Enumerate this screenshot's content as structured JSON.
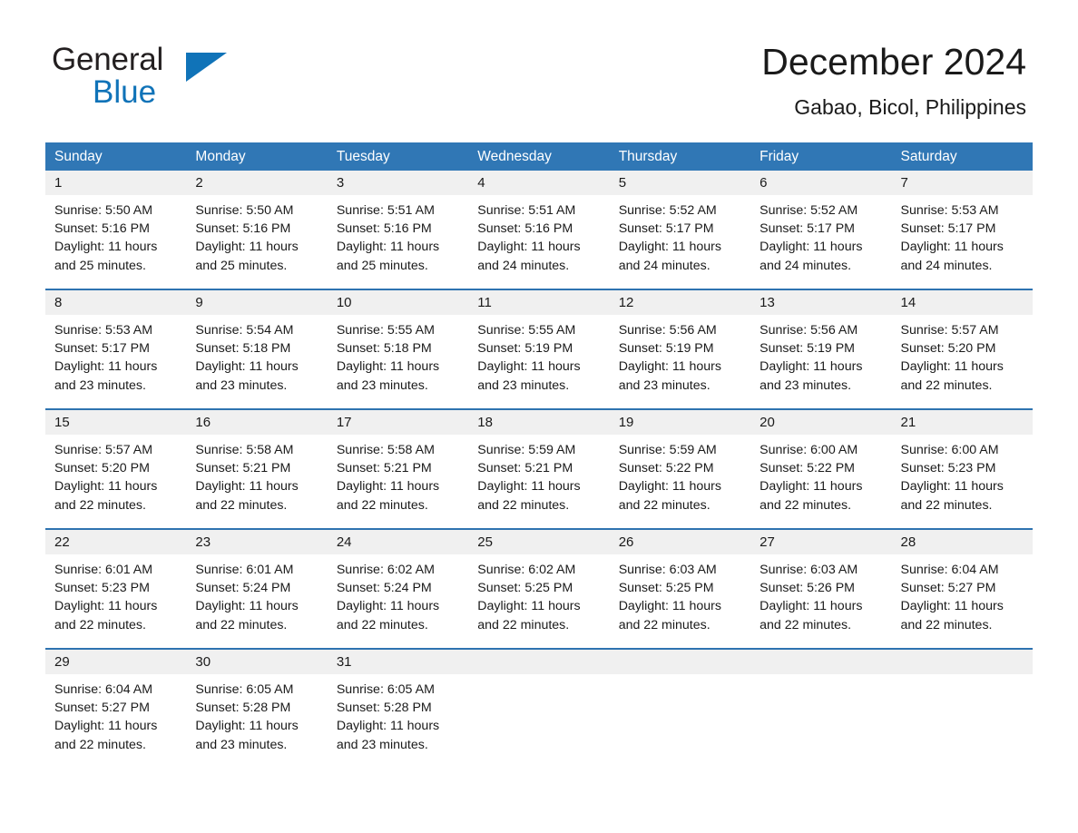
{
  "brand": {
    "name_part1": "General",
    "name_part2": "Blue",
    "accent_color": "#1073b8"
  },
  "header": {
    "title": "December 2024",
    "location": "Gabao, Bicol, Philippines"
  },
  "calendar": {
    "header_bg": "#3077b5",
    "row_separator_color": "#2e73b0",
    "daynum_bg": "#f0f0f0",
    "weekdays": [
      "Sunday",
      "Monday",
      "Tuesday",
      "Wednesday",
      "Thursday",
      "Friday",
      "Saturday"
    ],
    "weeks": [
      [
        {
          "day": "1",
          "sunrise": "Sunrise: 5:50 AM",
          "sunset": "Sunset: 5:16 PM",
          "daylight": "Daylight: 11 hours and 25 minutes."
        },
        {
          "day": "2",
          "sunrise": "Sunrise: 5:50 AM",
          "sunset": "Sunset: 5:16 PM",
          "daylight": "Daylight: 11 hours and 25 minutes."
        },
        {
          "day": "3",
          "sunrise": "Sunrise: 5:51 AM",
          "sunset": "Sunset: 5:16 PM",
          "daylight": "Daylight: 11 hours and 25 minutes."
        },
        {
          "day": "4",
          "sunrise": "Sunrise: 5:51 AM",
          "sunset": "Sunset: 5:16 PM",
          "daylight": "Daylight: 11 hours and 24 minutes."
        },
        {
          "day": "5",
          "sunrise": "Sunrise: 5:52 AM",
          "sunset": "Sunset: 5:17 PM",
          "daylight": "Daylight: 11 hours and 24 minutes."
        },
        {
          "day": "6",
          "sunrise": "Sunrise: 5:52 AM",
          "sunset": "Sunset: 5:17 PM",
          "daylight": "Daylight: 11 hours and 24 minutes."
        },
        {
          "day": "7",
          "sunrise": "Sunrise: 5:53 AM",
          "sunset": "Sunset: 5:17 PM",
          "daylight": "Daylight: 11 hours and 24 minutes."
        }
      ],
      [
        {
          "day": "8",
          "sunrise": "Sunrise: 5:53 AM",
          "sunset": "Sunset: 5:17 PM",
          "daylight": "Daylight: 11 hours and 23 minutes."
        },
        {
          "day": "9",
          "sunrise": "Sunrise: 5:54 AM",
          "sunset": "Sunset: 5:18 PM",
          "daylight": "Daylight: 11 hours and 23 minutes."
        },
        {
          "day": "10",
          "sunrise": "Sunrise: 5:55 AM",
          "sunset": "Sunset: 5:18 PM",
          "daylight": "Daylight: 11 hours and 23 minutes."
        },
        {
          "day": "11",
          "sunrise": "Sunrise: 5:55 AM",
          "sunset": "Sunset: 5:19 PM",
          "daylight": "Daylight: 11 hours and 23 minutes."
        },
        {
          "day": "12",
          "sunrise": "Sunrise: 5:56 AM",
          "sunset": "Sunset: 5:19 PM",
          "daylight": "Daylight: 11 hours and 23 minutes."
        },
        {
          "day": "13",
          "sunrise": "Sunrise: 5:56 AM",
          "sunset": "Sunset: 5:19 PM",
          "daylight": "Daylight: 11 hours and 23 minutes."
        },
        {
          "day": "14",
          "sunrise": "Sunrise: 5:57 AM",
          "sunset": "Sunset: 5:20 PM",
          "daylight": "Daylight: 11 hours and 22 minutes."
        }
      ],
      [
        {
          "day": "15",
          "sunrise": "Sunrise: 5:57 AM",
          "sunset": "Sunset: 5:20 PM",
          "daylight": "Daylight: 11 hours and 22 minutes."
        },
        {
          "day": "16",
          "sunrise": "Sunrise: 5:58 AM",
          "sunset": "Sunset: 5:21 PM",
          "daylight": "Daylight: 11 hours and 22 minutes."
        },
        {
          "day": "17",
          "sunrise": "Sunrise: 5:58 AM",
          "sunset": "Sunset: 5:21 PM",
          "daylight": "Daylight: 11 hours and 22 minutes."
        },
        {
          "day": "18",
          "sunrise": "Sunrise: 5:59 AM",
          "sunset": "Sunset: 5:21 PM",
          "daylight": "Daylight: 11 hours and 22 minutes."
        },
        {
          "day": "19",
          "sunrise": "Sunrise: 5:59 AM",
          "sunset": "Sunset: 5:22 PM",
          "daylight": "Daylight: 11 hours and 22 minutes."
        },
        {
          "day": "20",
          "sunrise": "Sunrise: 6:00 AM",
          "sunset": "Sunset: 5:22 PM",
          "daylight": "Daylight: 11 hours and 22 minutes."
        },
        {
          "day": "21",
          "sunrise": "Sunrise: 6:00 AM",
          "sunset": "Sunset: 5:23 PM",
          "daylight": "Daylight: 11 hours and 22 minutes."
        }
      ],
      [
        {
          "day": "22",
          "sunrise": "Sunrise: 6:01 AM",
          "sunset": "Sunset: 5:23 PM",
          "daylight": "Daylight: 11 hours and 22 minutes."
        },
        {
          "day": "23",
          "sunrise": "Sunrise: 6:01 AM",
          "sunset": "Sunset: 5:24 PM",
          "daylight": "Daylight: 11 hours and 22 minutes."
        },
        {
          "day": "24",
          "sunrise": "Sunrise: 6:02 AM",
          "sunset": "Sunset: 5:24 PM",
          "daylight": "Daylight: 11 hours and 22 minutes."
        },
        {
          "day": "25",
          "sunrise": "Sunrise: 6:02 AM",
          "sunset": "Sunset: 5:25 PM",
          "daylight": "Daylight: 11 hours and 22 minutes."
        },
        {
          "day": "26",
          "sunrise": "Sunrise: 6:03 AM",
          "sunset": "Sunset: 5:25 PM",
          "daylight": "Daylight: 11 hours and 22 minutes."
        },
        {
          "day": "27",
          "sunrise": "Sunrise: 6:03 AM",
          "sunset": "Sunset: 5:26 PM",
          "daylight": "Daylight: 11 hours and 22 minutes."
        },
        {
          "day": "28",
          "sunrise": "Sunrise: 6:04 AM",
          "sunset": "Sunset: 5:27 PM",
          "daylight": "Daylight: 11 hours and 22 minutes."
        }
      ],
      [
        {
          "day": "29",
          "sunrise": "Sunrise: 6:04 AM",
          "sunset": "Sunset: 5:27 PM",
          "daylight": "Daylight: 11 hours and 22 minutes."
        },
        {
          "day": "30",
          "sunrise": "Sunrise: 6:05 AM",
          "sunset": "Sunset: 5:28 PM",
          "daylight": "Daylight: 11 hours and 23 minutes."
        },
        {
          "day": "31",
          "sunrise": "Sunrise: 6:05 AM",
          "sunset": "Sunset: 5:28 PM",
          "daylight": "Daylight: 11 hours and 23 minutes."
        },
        {
          "day": "",
          "sunrise": "",
          "sunset": "",
          "daylight": ""
        },
        {
          "day": "",
          "sunrise": "",
          "sunset": "",
          "daylight": ""
        },
        {
          "day": "",
          "sunrise": "",
          "sunset": "",
          "daylight": ""
        },
        {
          "day": "",
          "sunrise": "",
          "sunset": "",
          "daylight": ""
        }
      ]
    ]
  }
}
